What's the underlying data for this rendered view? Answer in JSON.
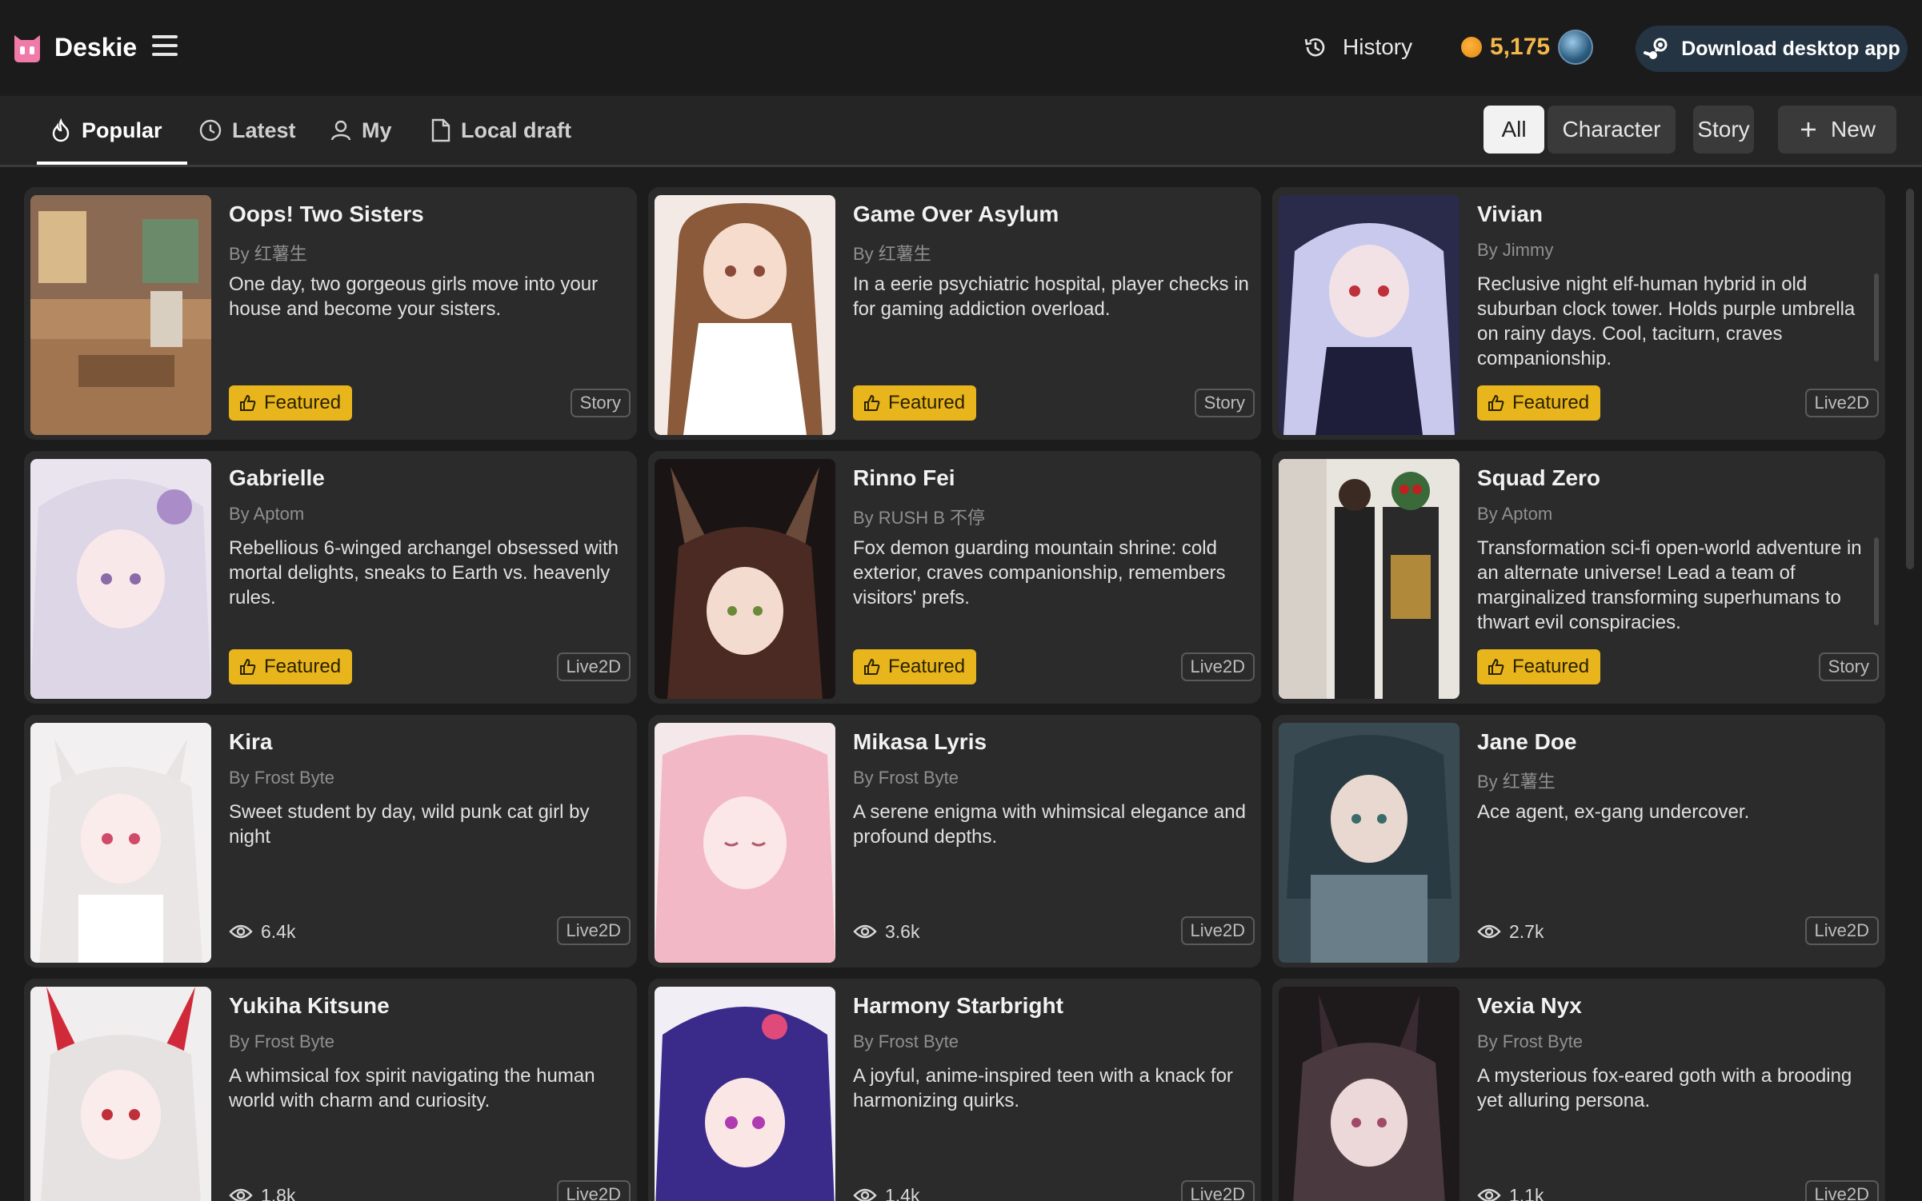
{
  "app": {
    "name": "Deskie"
  },
  "header": {
    "history_label": "History",
    "coins": "5,175",
    "download_label": "Download desktop app"
  },
  "tabs": [
    {
      "label": "Popular",
      "icon": "fire-icon",
      "active": true
    },
    {
      "label": "Latest",
      "icon": "clock-icon",
      "active": false
    },
    {
      "label": "My",
      "icon": "user-icon",
      "active": false
    },
    {
      "label": "Local draft",
      "icon": "document-icon",
      "active": false
    }
  ],
  "filters": [
    {
      "label": "All",
      "selected": true
    },
    {
      "label": "Character",
      "selected": false
    },
    {
      "label": "Story",
      "selected": false
    }
  ],
  "new_label": "New",
  "featured_label": "Featured",
  "colors": {
    "accent": "#e8b51c",
    "coin": "#f4b84a",
    "download_bg": "#243443"
  },
  "cards": [
    {
      "title": "Oops! Two Sisters",
      "author": "By 红薯生",
      "description": "One day, two gorgeous girls move into your house and become your sisters.",
      "badge": "Featured",
      "views": "",
      "tag": "Story"
    },
    {
      "title": "Game Over Asylum",
      "author": "By 红薯生",
      "description": "In a eerie psychiatric hospital, player checks in for gaming addiction overload.",
      "badge": "Featured",
      "views": "",
      "tag": "Story"
    },
    {
      "title": "Vivian",
      "author": "By Jimmy",
      "description": "Reclusive night elf-human hybrid in old suburban clock tower. Holds purple umbrella on rainy days. Cool, taciturn, craves companionship.",
      "badge": "Featured",
      "views": "",
      "tag": "Live2D"
    },
    {
      "title": "Gabrielle",
      "author": "By Aptom",
      "description": "Rebellious 6-winged archangel obsessed with mortal delights, sneaks to Earth vs. heavenly rules.",
      "badge": "Featured",
      "views": "",
      "tag": "Live2D"
    },
    {
      "title": "Rinno Fei",
      "author": "By RUSH B 不停",
      "description": "Fox demon guarding mountain shrine: cold exterior, craves companionship, remembers visitors' prefs.",
      "badge": "Featured",
      "views": "",
      "tag": "Live2D"
    },
    {
      "title": "Squad Zero",
      "author": "By Aptom",
      "description": "Transformation sci-fi open-world adventure in an alternate universe! Lead a team of marginalized transforming superhumans to thwart evil conspiracies.",
      "badge": "Featured",
      "views": "",
      "tag": "Story"
    },
    {
      "title": "Kira",
      "author": "By Frost Byte",
      "description": "Sweet student by day, wild punk cat girl by night",
      "badge": "",
      "views": "6.4k",
      "tag": "Live2D"
    },
    {
      "title": "Mikasa Lyris",
      "author": "By Frost Byte",
      "description": "A serene enigma with whimsical elegance and profound depths.",
      "badge": "",
      "views": "3.6k",
      "tag": "Live2D"
    },
    {
      "title": "Jane Doe",
      "author": "By 红薯生",
      "description": "Ace agent, ex-gang undercover.",
      "badge": "",
      "views": "2.7k",
      "tag": "Live2D"
    },
    {
      "title": "Yukiha Kitsune",
      "author": "By Frost Byte",
      "description": "A whimsical fox spirit navigating the human world with charm and curiosity.",
      "badge": "",
      "views": "1.8k",
      "tag": "Live2D"
    },
    {
      "title": "Harmony Starbright",
      "author": "By Frost Byte",
      "description": "A joyful, anime-inspired teen with a knack for harmonizing quirks.",
      "badge": "",
      "views": "1.4k",
      "tag": "Live2D"
    },
    {
      "title": "Vexia Nyx",
      "author": "By Frost Byte",
      "description": "A mysterious fox-eared goth with a brooding yet alluring persona.",
      "badge": "",
      "views": "1.1k",
      "tag": "Live2D"
    }
  ]
}
